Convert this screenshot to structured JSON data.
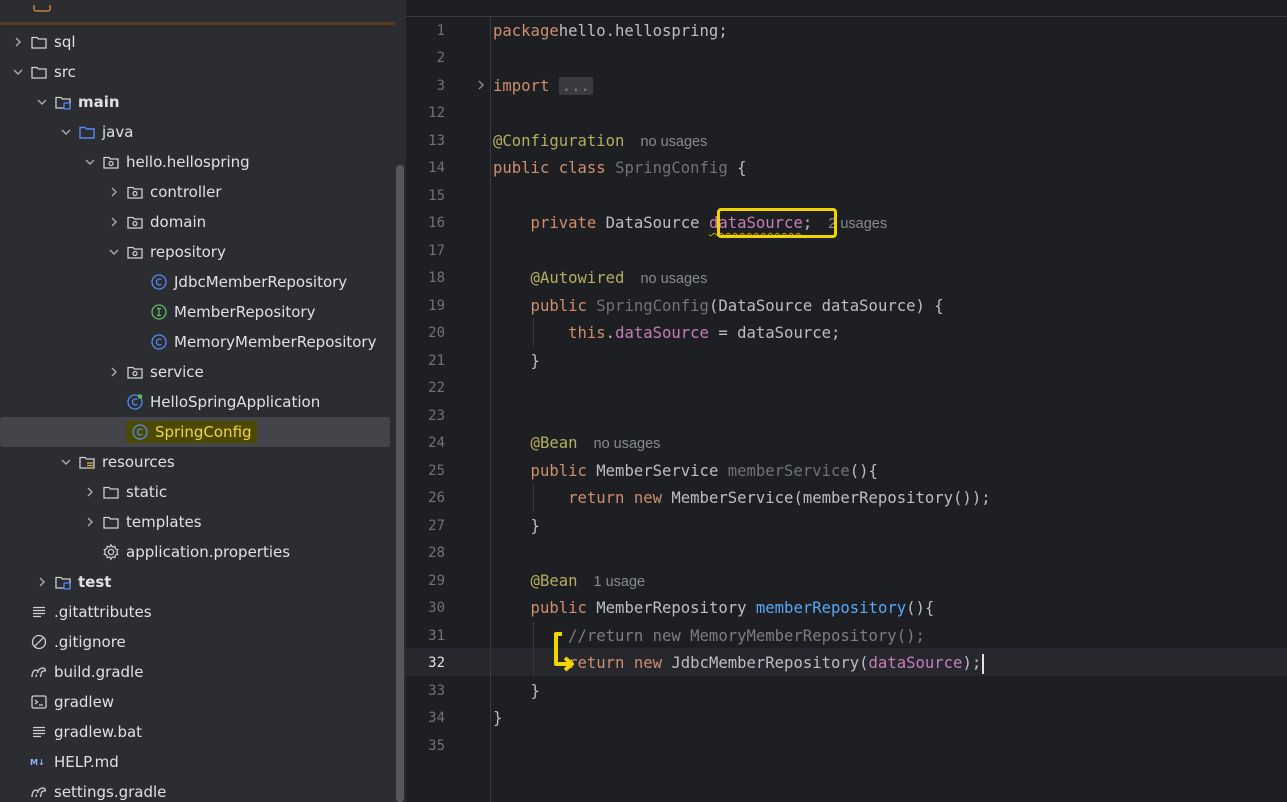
{
  "project_tree": {
    "items": [
      {
        "label": "sql",
        "icon": "folder-icon",
        "expanded": false,
        "bold": false
      },
      {
        "label": "src",
        "icon": "folder-icon",
        "expanded": true,
        "bold": false
      },
      {
        "label": "main",
        "icon": "module-folder-icon",
        "expanded": true,
        "bold": true
      },
      {
        "label": "java",
        "icon": "source-folder-icon",
        "expanded": true,
        "bold": false
      },
      {
        "label": "hello.hellospring",
        "icon": "package-icon",
        "expanded": true,
        "bold": false
      },
      {
        "label": "controller",
        "icon": "package-icon",
        "expanded": false,
        "bold": false
      },
      {
        "label": "domain",
        "icon": "package-icon",
        "expanded": false,
        "bold": false
      },
      {
        "label": "repository",
        "icon": "package-icon",
        "expanded": true,
        "bold": false
      },
      {
        "label": "JdbcMemberRepository",
        "icon": "class-icon",
        "bold": false
      },
      {
        "label": "MemberRepository",
        "icon": "interface-icon",
        "bold": false
      },
      {
        "label": "MemoryMemberRepository",
        "icon": "class-icon",
        "bold": false
      },
      {
        "label": "service",
        "icon": "package-icon",
        "expanded": false,
        "bold": false
      },
      {
        "label": "HelloSpringApplication",
        "icon": "spring-boot-class-icon",
        "bold": false
      },
      {
        "label": "SpringConfig",
        "icon": "class-icon",
        "bold": false,
        "selected": true
      },
      {
        "label": "resources",
        "icon": "resources-folder-icon",
        "expanded": true,
        "bold": false
      },
      {
        "label": "static",
        "icon": "folder-icon",
        "expanded": false,
        "bold": false
      },
      {
        "label": "templates",
        "icon": "folder-icon",
        "expanded": false,
        "bold": false
      },
      {
        "label": "application.properties",
        "icon": "gear-icon",
        "bold": false
      },
      {
        "label": "test",
        "icon": "module-folder-icon",
        "expanded": false,
        "bold": true
      },
      {
        "label": ".gitattributes",
        "icon": "text-file-icon",
        "bold": false
      },
      {
        "label": ".gitignore",
        "icon": "ignore-file-icon",
        "bold": false
      },
      {
        "label": "build.gradle",
        "icon": "gradle-icon",
        "bold": false
      },
      {
        "label": "gradlew",
        "icon": "terminal-icon",
        "bold": false
      },
      {
        "label": "gradlew.bat",
        "icon": "text-file-icon",
        "bold": false
      },
      {
        "label": "HELP.md",
        "icon": "markdown-icon",
        "bold": false
      },
      {
        "label": "settings.gradle",
        "icon": "gradle-icon",
        "bold": false
      }
    ]
  },
  "editor": {
    "file": "SpringConfig",
    "current_line": "32",
    "lines": [
      {
        "n": "1",
        "t": [
          [
            "kw",
            "package"
          ],
          [
            "",
            "hello.hellospring;"
          ]
        ]
      },
      {
        "n": "2",
        "t": []
      },
      {
        "n": "3",
        "t": [
          [
            "kw",
            "import"
          ],
          [
            "",
            "fold",
            ""
          ]
        ]
      },
      {
        "n": "12",
        "t": []
      },
      {
        "n": "13",
        "t": [
          [
            "ann",
            "@Configuration"
          ]
        ],
        "hint": "no usages"
      },
      {
        "n": "14",
        "t": [
          [
            "kw",
            "public class "
          ],
          [
            "grey",
            "SpringConfig"
          ],
          [
            "",
            " {"
          ]
        ]
      },
      {
        "n": "15",
        "t": []
      },
      {
        "n": "16",
        "t": [
          [
            "kw",
            "    private "
          ],
          [
            "",
            "DataSource "
          ],
          [
            "fldsq",
            "dataSource"
          ],
          [
            "",
            ";"
          ]
        ],
        "hint": "2 usages"
      },
      {
        "n": "17",
        "t": []
      },
      {
        "n": "18",
        "t": [
          [
            "ann",
            "    @Autowired"
          ]
        ],
        "hint": "no usages"
      },
      {
        "n": "19",
        "t": [
          [
            "kw",
            "    public "
          ],
          [
            "grey",
            "SpringConfig"
          ],
          [
            "",
            "(DataSource dataSource) {"
          ]
        ]
      },
      {
        "n": "20",
        "t": [
          [
            "kw",
            "        this"
          ],
          [
            "",
            "."
          ],
          [
            "fld",
            "dataSource"
          ],
          [
            "",
            " = dataSource;"
          ]
        ]
      },
      {
        "n": "21",
        "t": [
          [
            "",
            "    }"
          ]
        ]
      },
      {
        "n": "22",
        "t": []
      },
      {
        "n": "23",
        "t": []
      },
      {
        "n": "24",
        "t": [
          [
            "ann",
            "    @Bean"
          ]
        ],
        "hint": "no usages"
      },
      {
        "n": "25",
        "t": [
          [
            "kw",
            "    public "
          ],
          [
            "",
            "MemberService "
          ],
          [
            "grey",
            "memberService"
          ],
          [
            "",
            "(){"
          ]
        ]
      },
      {
        "n": "26",
        "t": [
          [
            "kw",
            "        return new "
          ],
          [
            "",
            "MemberService(memberRepository());"
          ]
        ]
      },
      {
        "n": "27",
        "t": [
          [
            "",
            "    }"
          ]
        ]
      },
      {
        "n": "28",
        "t": []
      },
      {
        "n": "29",
        "t": [
          [
            "ann",
            "    @Bean"
          ]
        ],
        "hint": "1 usage"
      },
      {
        "n": "30",
        "t": [
          [
            "kw",
            "    public "
          ],
          [
            "",
            "MemberRepository "
          ],
          [
            "fn",
            "memberRepository"
          ],
          [
            "",
            "(){"
          ]
        ]
      },
      {
        "n": "31",
        "t": [
          [
            "cmt",
            "        //return new MemoryMemberRepository();"
          ]
        ]
      },
      {
        "n": "32",
        "t": [
          [
            "kw",
            "        return new "
          ],
          [
            "",
            "JdbcMemberRepository("
          ],
          [
            "fld",
            "dataSource"
          ],
          [
            "",
            ");"
          ]
        ],
        "caret": true
      },
      {
        "n": "33",
        "t": [
          [
            "",
            "    }"
          ]
        ]
      },
      {
        "n": "34",
        "t": [
          [
            "",
            "}"
          ]
        ]
      },
      {
        "n": "35",
        "t": []
      }
    ],
    "fold_placeholder": "..."
  },
  "colors": {
    "annotation_highlight": "#f2d400",
    "keyword": "#cf8e6d",
    "annotation": "#b3ae60",
    "field": "#c77dbb",
    "method": "#56a8f5"
  }
}
